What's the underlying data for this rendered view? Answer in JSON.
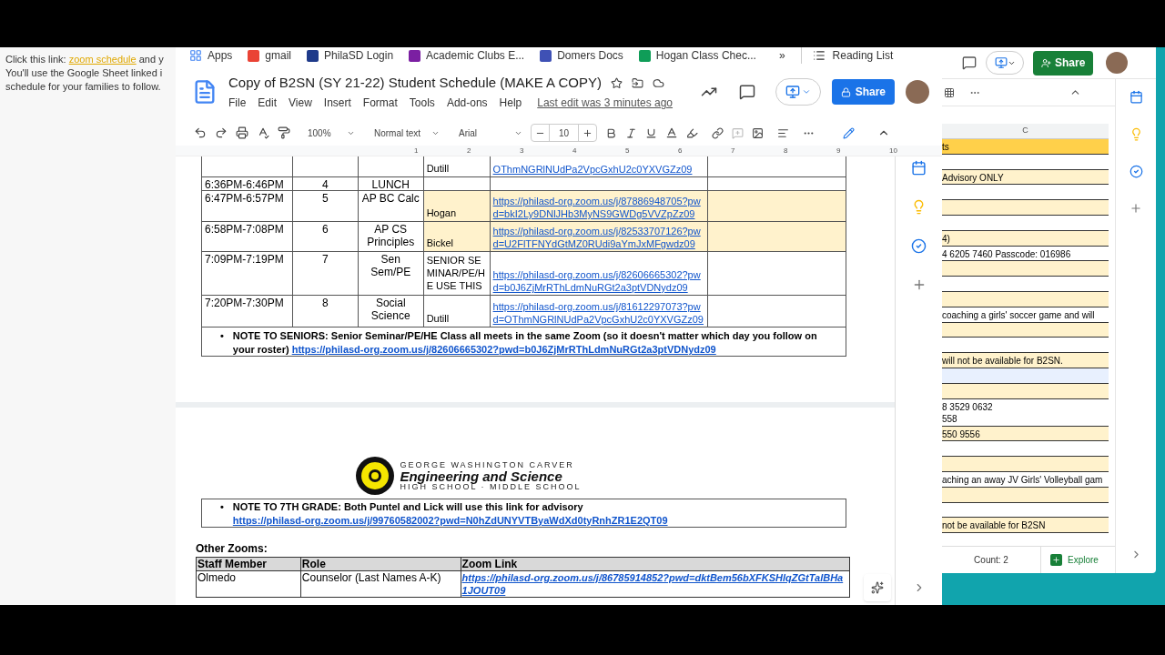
{
  "background_page": {
    "link_line": {
      "before": "Click this link: ",
      "link": "zoom schedule",
      "after": " and y"
    },
    "lines": [
      "You'll use the Google Sheet linked i",
      "schedule for your families to follow."
    ]
  },
  "docs": {
    "bookmarks": [
      "Apps",
      "gmail",
      "PhilaSD Login",
      "Academic Clubs E...",
      "Domers Docs",
      "Hogan Class Chec..."
    ],
    "bookmarks_overflow": "»",
    "reading_list": "Reading List",
    "title": "Copy of B2SN (SY 21-22) Student Schedule (MAKE A COPY)",
    "menu": [
      "File",
      "Edit",
      "View",
      "Insert",
      "Format",
      "Tools",
      "Add-ons",
      "Help"
    ],
    "last_edit": "Last edit was 3 minutes ago",
    "share": "Share",
    "toolbar": {
      "zoom": "100%",
      "style": "Normal text",
      "font": "Arial",
      "size": "10"
    },
    "ruler": [
      "1",
      "2",
      "3",
      "4",
      "5",
      "6",
      "7",
      "8",
      "9",
      "10"
    ],
    "schedule": [
      {
        "teacher": "Dutill",
        "link": "OThmNGRlNUdPa2VpcGxhU2c0YXVGZz09",
        "highlighted": false
      },
      {
        "time": "6:36PM-6:46PM",
        "period": "4",
        "course": "LUNCH",
        "highlighted": false
      },
      {
        "time": "6:47PM-6:57PM",
        "period": "5",
        "course": "AP BC Calc",
        "teacher": "Hogan",
        "link": "https://philasd-org.zoom.us/j/87886948705?pwd=bkI2Ly9DNlJHb3MyNS9GWDg5VVZpZz09",
        "highlighted": true
      },
      {
        "time": "6:58PM-7:08PM",
        "period": "6",
        "course": "AP CS Principles",
        "teacher": "Bickel",
        "link": "https://philasd-org.zoom.us/j/82533707126?pwd=U2FlTFNYdGtMZ0RUdi9aYmJxMFgwdz09",
        "highlighted": true
      },
      {
        "time": "7:09PM-7:19PM",
        "period": "7",
        "course": "Sen Sem/PE",
        "teacher": "SENIOR SEMINAR/PE/HE USE THIS",
        "link": "https://philasd-org.zoom.us/j/82606665302?pwd=b0J6ZjMrRThLdmNuRGt2a3ptVDNydz09",
        "highlighted": false
      },
      {
        "time": "7:20PM-7:30PM",
        "period": "8",
        "course": "Social Science",
        "teacher": "Dutill",
        "link": "https://philasd-org.zoom.us/j/81612297073?pwd=OThmNGRlNUdPa2VpcGxhU2c0YXVGZz09",
        "highlighted": false
      }
    ],
    "senior_note": {
      "bullet": "•",
      "text": "NOTE TO SENIORS:   Senior Seminar/PE/HE Class all meets in the same Zoom (so it doesn't matter which day you follow on your roster)",
      "link": "https://philasd-org.zoom.us/j/82606665302?pwd=b0J6ZjMrRThLdmNuRGt2a3ptVDNydz09"
    },
    "logo": {
      "top": "GEORGE WASHINGTON CARVER",
      "middle": "Engineering and Science",
      "bottom": "HIGH SCHOOL · MIDDLE SCHOOL"
    },
    "grade7_note": {
      "bullet": "•",
      "text": "NOTE TO 7TH GRADE:  Both Puntel and Lick will use this link for advisory",
      "link": "https://philasd-org.zoom.us/j/99760582002?pwd=N0hZdUNYVTByaWdXd0tyRnhZR1E2QT09"
    },
    "other_zooms": {
      "heading": "Other Zooms:",
      "columns": [
        "Staff Member",
        "Role",
        "Zoom Link"
      ],
      "rows": [
        {
          "staff": "Olmedo",
          "role": "Counselor (Last Names A-K)",
          "link": "https://philasd-org.zoom.us/j/86785914852?pwd=dktBem56bXFKSHlqZGtTalBHa1JOUT09"
        }
      ]
    }
  },
  "sheet": {
    "share": "Share",
    "column": "C",
    "rows": [
      {
        "kind": "header",
        "lines": [
          "ts"
        ]
      },
      {
        "kind": "plain",
        "lines": []
      },
      {
        "kind": "yellow",
        "lines": [
          "Advisory ONLY"
        ]
      },
      {
        "kind": "plain",
        "lines": []
      },
      {
        "kind": "yellow",
        "lines": []
      },
      {
        "kind": "plain",
        "lines": []
      },
      {
        "kind": "yellow",
        "lines": [
          "4)"
        ]
      },
      {
        "kind": "plain",
        "lines": [
          "4 6205 7460 Passcode: 016986"
        ]
      },
      {
        "kind": "yellow",
        "lines": []
      },
      {
        "kind": "plain",
        "lines": []
      },
      {
        "kind": "yellow",
        "lines": []
      },
      {
        "kind": "plain",
        "lines": [
          "coaching a girls' soccer game and will"
        ]
      },
      {
        "kind": "yellow",
        "lines": []
      },
      {
        "kind": "plain",
        "lines": []
      },
      {
        "kind": "yellow",
        "lines": [
          "will not be available for B2SN."
        ]
      },
      {
        "kind": "selected",
        "lines": []
      },
      {
        "kind": "yellow",
        "lines": []
      },
      {
        "kind": "plain",
        "lines": [
          "8 3529 0632",
          "558"
        ]
      },
      {
        "kind": "yellow",
        "lines": [
          "550 9556"
        ]
      },
      {
        "kind": "plain",
        "lines": []
      },
      {
        "kind": "yellow",
        "lines": []
      },
      {
        "kind": "plain",
        "lines": [
          "aching an away JV Girls' Volleyball gam"
        ]
      },
      {
        "kind": "yellow",
        "lines": []
      },
      {
        "kind": "plain",
        "lines": []
      },
      {
        "kind": "yellow",
        "lines": [
          "not be available for B2SN"
        ]
      }
    ],
    "count": "Count: 2",
    "explore": "Explore"
  }
}
